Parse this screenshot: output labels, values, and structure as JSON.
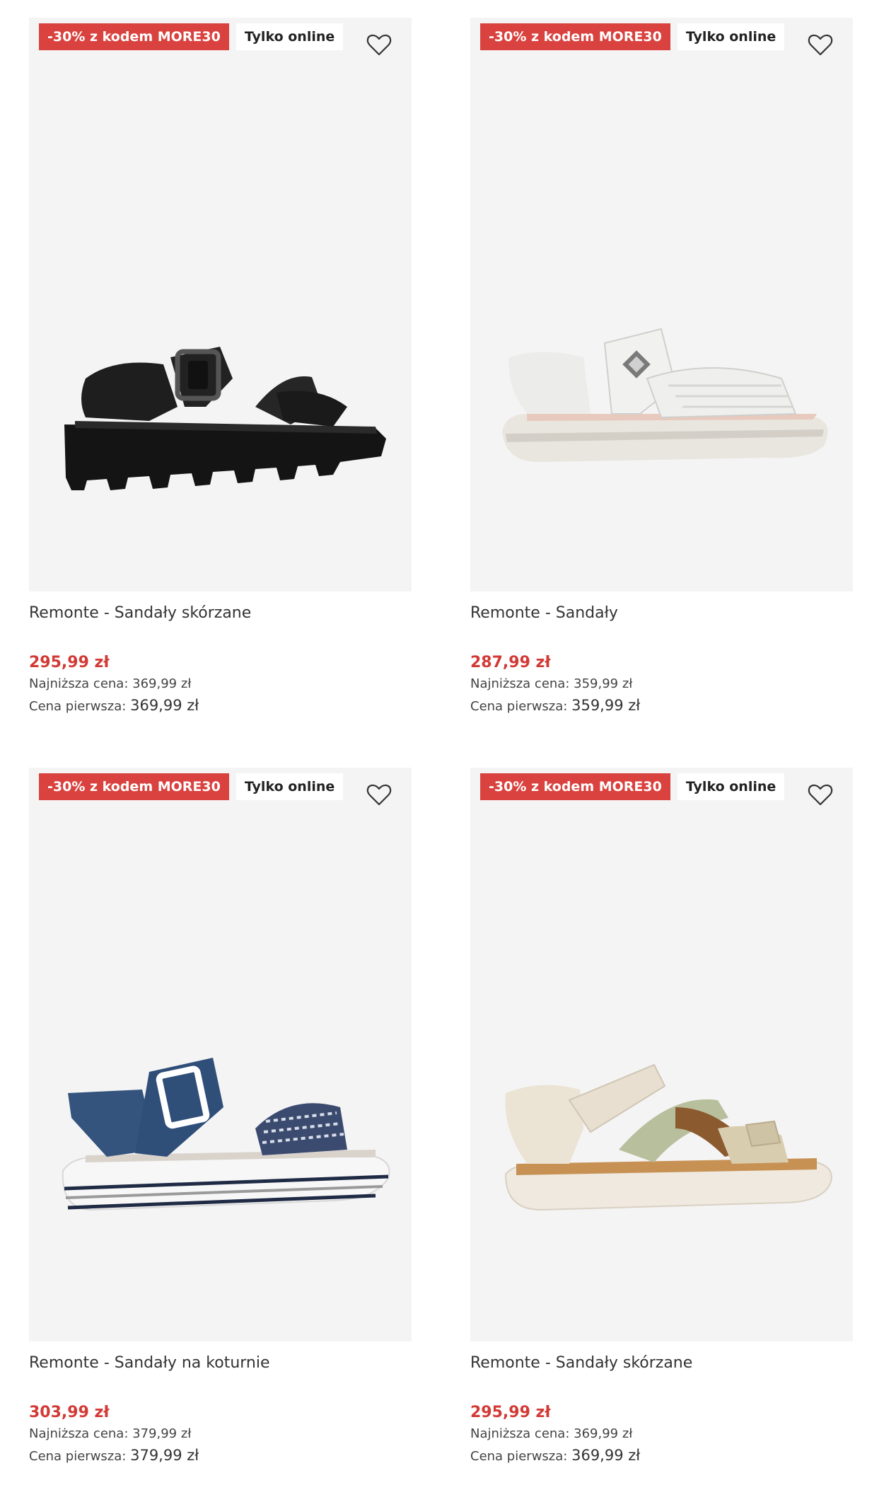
{
  "products": [
    {
      "promo_badge": "-30% z kodem MORE30",
      "online_badge": "Tylko online",
      "name": "Remonte - Sandały skórzane",
      "price": "295,99 zł",
      "lowest_label": "Najniższa cena:",
      "lowest_value": "369,99 zł",
      "first_label": "Cena pierwsza:",
      "first_value": "369,99 zł",
      "colors": {
        "main": "#1c1c1c"
      }
    },
    {
      "promo_badge": "-30% z kodem MORE30",
      "online_badge": "Tylko online",
      "name": "Remonte - Sandały",
      "price": "287,99 zł",
      "lowest_label": "Najniższa cena:",
      "lowest_value": "359,99 zł",
      "first_label": "Cena pierwsza:",
      "first_value": "359,99 zł",
      "colors": {
        "main": "#e4e4e2"
      }
    },
    {
      "promo_badge": "-30% z kodem MORE30",
      "online_badge": "Tylko online",
      "name": "Remonte - Sandały na koturnie",
      "price": "303,99 zł",
      "lowest_label": "Najniższa cena:",
      "lowest_value": "379,99 zł",
      "first_label": "Cena pierwsza:",
      "first_value": "379,99 zł",
      "colors": {
        "main": "#34547e"
      }
    },
    {
      "promo_badge": "-30% z kodem MORE30",
      "online_badge": "Tylko online",
      "name": "Remonte - Sandały skórzane",
      "price": "295,99 zł",
      "lowest_label": "Najniższa cena:",
      "lowest_value": "369,99 zł",
      "first_label": "Cena pierwsza:",
      "first_value": "369,99 zł",
      "colors": {
        "main": "#e6ddcf"
      }
    }
  ],
  "icons": {
    "wishlist": "heart-outline-icon"
  },
  "colors": {
    "promo": "#d9423e",
    "price": "#d23a36",
    "image_bg": "#f4f4f4"
  }
}
